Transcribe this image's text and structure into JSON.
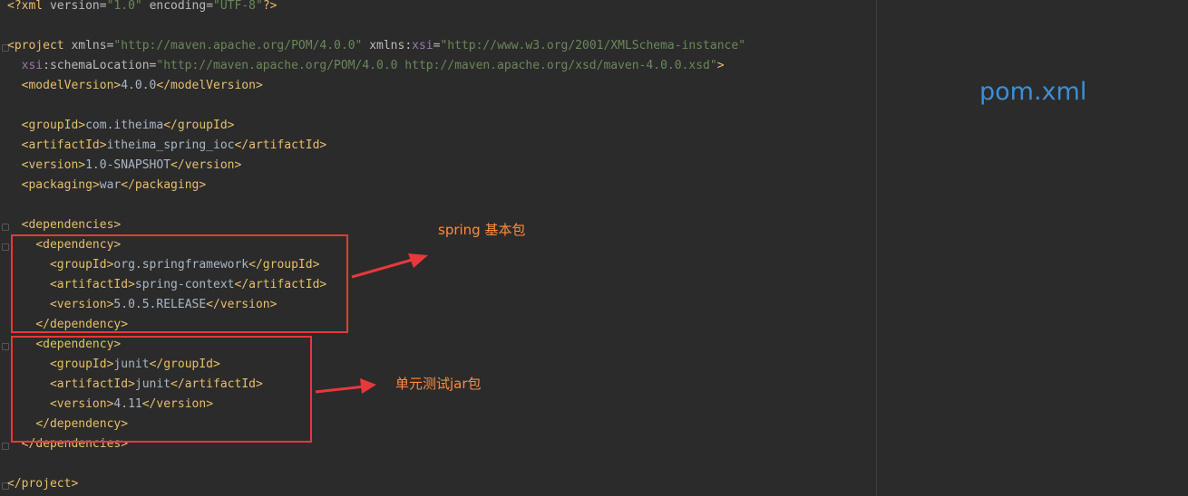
{
  "file_title": "pom.xml",
  "code": {
    "xml_decl": {
      "name": "xml",
      "version_attr": "version",
      "version_val": "\"1.0\"",
      "encoding_attr": "encoding",
      "encoding_val": "\"UTF-8\""
    },
    "project": {
      "tag": "project",
      "xmlns_attr": "xmlns",
      "xmlns_val": "\"http://maven.apache.org/POM/4.0.0\"",
      "xsi_ns": "xmlns",
      "xsi_prefix": "xsi",
      "xsi_val": "\"http://www.w3.org/2001/XMLSchema-instance\"",
      "schema_prefix": "xsi",
      "schema_attr": "schemaLocation",
      "schema_val": "\"http://maven.apache.org/POM/4.0.0 http://maven.apache.org/xsd/maven-4.0.0.xsd\""
    },
    "model_version": {
      "tag": "modelVersion",
      "value": "4.0.0"
    },
    "group_id": {
      "tag": "groupId",
      "value": "com.itheima"
    },
    "artifact_id": {
      "tag": "artifactId",
      "value": "itheima_spring_ioc"
    },
    "version": {
      "tag": "version",
      "value": "1.0-SNAPSHOT"
    },
    "packaging": {
      "tag": "packaging",
      "value": "war"
    },
    "dependencies_tag": "dependencies",
    "dependency_tag": "dependency",
    "dep1": {
      "groupId": "org.springframework",
      "artifactId": "spring-context",
      "version": "5.0.5.RELEASE"
    },
    "dep2": {
      "groupId": "junit",
      "artifactId": "junit",
      "version": "4.11"
    }
  },
  "annotations": {
    "spring": "spring 基本包",
    "junit": "单元测试jar包"
  },
  "colors": {
    "box": "#e8383b",
    "annotation": "#ff8a3c",
    "title": "#3b8fd9"
  }
}
